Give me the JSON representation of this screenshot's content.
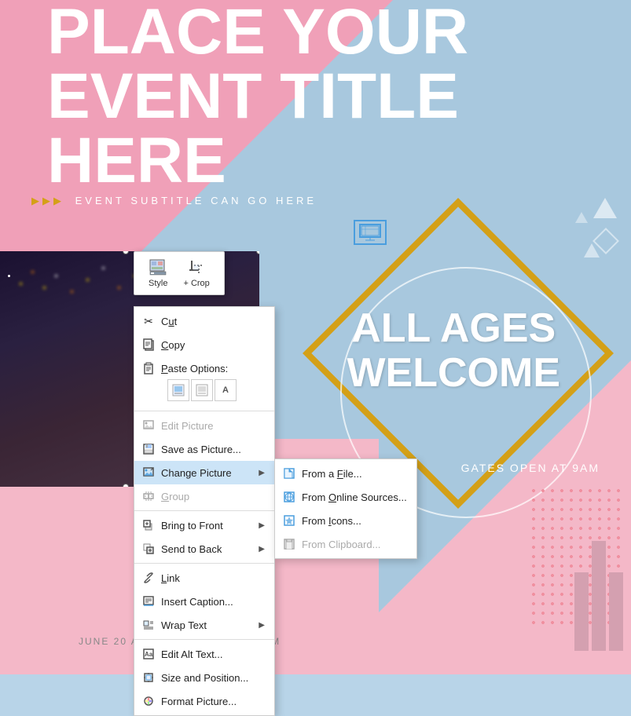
{
  "background": {
    "colors": {
      "blue": "#a8c8de",
      "pink": "#f0a0b8",
      "gold": "#d4a017",
      "white": "#ffffff"
    }
  },
  "poster": {
    "title_line1": "PLACE YOUR",
    "title_line2": "EVENT TITLE",
    "title_line3": "HERE",
    "subtitle": "EVENT SUBTITLE CAN GO HERE",
    "all_ages_line1": "ALL AGES",
    "all_ages_line2": "WELCOME",
    "gates_open": "GATES OPEN AT 9AM",
    "bottom_text": "JUNE 20 AT INFO@FABRIKAM.COM"
  },
  "toolbar": {
    "style_label": "Style",
    "crop_label": "+ Crop",
    "style_icon": "🖼",
    "crop_icon": "✂"
  },
  "context_menu": {
    "items": [
      {
        "id": "cut",
        "label": "Cut",
        "icon": "✂",
        "has_submenu": false,
        "disabled": false,
        "underline_index": 1
      },
      {
        "id": "copy",
        "label": "Copy",
        "icon": "📋",
        "has_submenu": false,
        "disabled": false,
        "underline_index": 1
      },
      {
        "id": "paste-options",
        "label": "Paste Options:",
        "icon": "📄",
        "has_submenu": false,
        "disabled": false,
        "is_paste": true
      },
      {
        "id": "edit-picture",
        "label": "Edit Picture",
        "icon": "✏",
        "has_submenu": false,
        "disabled": true,
        "underline_index": 5
      },
      {
        "id": "save-as-picture",
        "label": "Save as Picture...",
        "icon": "💾",
        "has_submenu": false,
        "disabled": false,
        "underline_index": 0
      },
      {
        "id": "change-picture",
        "label": "Change Picture",
        "icon": "🖼",
        "has_submenu": true,
        "disabled": false,
        "underline_index": 1,
        "active": true
      },
      {
        "id": "group",
        "label": "Group",
        "icon": "⊞",
        "has_submenu": false,
        "disabled": true,
        "underline_index": 0
      },
      {
        "id": "bring-to-front",
        "label": "Bring to Front",
        "icon": "⬆",
        "has_submenu": true,
        "disabled": false,
        "underline_index": 0
      },
      {
        "id": "send-to-back",
        "label": "Send to Back",
        "icon": "⬇",
        "has_submenu": true,
        "disabled": false,
        "underline_index": 0
      },
      {
        "id": "link",
        "label": "Link",
        "icon": "🔗",
        "has_submenu": false,
        "disabled": false,
        "underline_index": 0
      },
      {
        "id": "insert-caption",
        "label": "Insert Caption...",
        "icon": "📝",
        "has_submenu": false,
        "disabled": false,
        "underline_index": 7
      },
      {
        "id": "wrap-text",
        "label": "Wrap Text",
        "icon": "↩",
        "has_submenu": true,
        "disabled": false,
        "underline_index": 0
      },
      {
        "id": "edit-alt-text",
        "label": "Edit Alt Text...",
        "icon": "Aa",
        "has_submenu": false,
        "disabled": false,
        "underline_index": 5
      },
      {
        "id": "size-and-position",
        "label": "Size and Position...",
        "icon": "⊡",
        "has_submenu": false,
        "disabled": false,
        "underline_index": 0
      },
      {
        "id": "format-picture",
        "label": "Format Picture...",
        "icon": "🎨",
        "has_submenu": false,
        "disabled": false,
        "underline_index": 7
      }
    ]
  },
  "submenu": {
    "items": [
      {
        "id": "from-file",
        "label": "From a File...",
        "icon": "📁",
        "disabled": false,
        "underline": 8
      },
      {
        "id": "from-online",
        "label": "From Online Sources...",
        "icon": "🌐",
        "disabled": false,
        "underline": 5
      },
      {
        "id": "from-icons",
        "label": "From Icons...",
        "icon": "⭐",
        "disabled": false,
        "underline": 5
      },
      {
        "id": "from-clipboard",
        "label": "From Clipboard...",
        "icon": "📋",
        "disabled": true,
        "underline": 5
      }
    ]
  }
}
